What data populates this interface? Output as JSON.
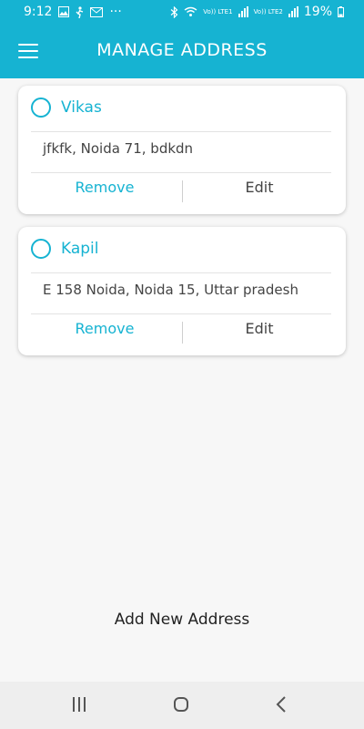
{
  "status": {
    "time": "9:12",
    "dots": "···",
    "lte1": "Vo)) LTE1",
    "lte2": "Vo)) LTE2",
    "battery": "19%"
  },
  "header": {
    "title": "MANAGE ADDRESS"
  },
  "addresses": [
    {
      "name": "Vikas",
      "address": "jfkfk, Noida 71, bdkdn",
      "remove_label": "Remove",
      "edit_label": "Edit"
    },
    {
      "name": "Kapil",
      "address": "E 158 Noida, Noida 15, Uttar pradesh",
      "remove_label": "Remove",
      "edit_label": "Edit"
    }
  ],
  "footer": {
    "add_label": "Add New Address"
  },
  "colors": {
    "accent": "#16b3d2",
    "text": "#444444",
    "background": "#f7f7f7"
  },
  "icons": [
    "menu-icon",
    "radio-icon",
    "recents-icon",
    "home-icon",
    "back-icon",
    "bluetooth-icon",
    "wifi-icon",
    "battery-icon"
  ]
}
